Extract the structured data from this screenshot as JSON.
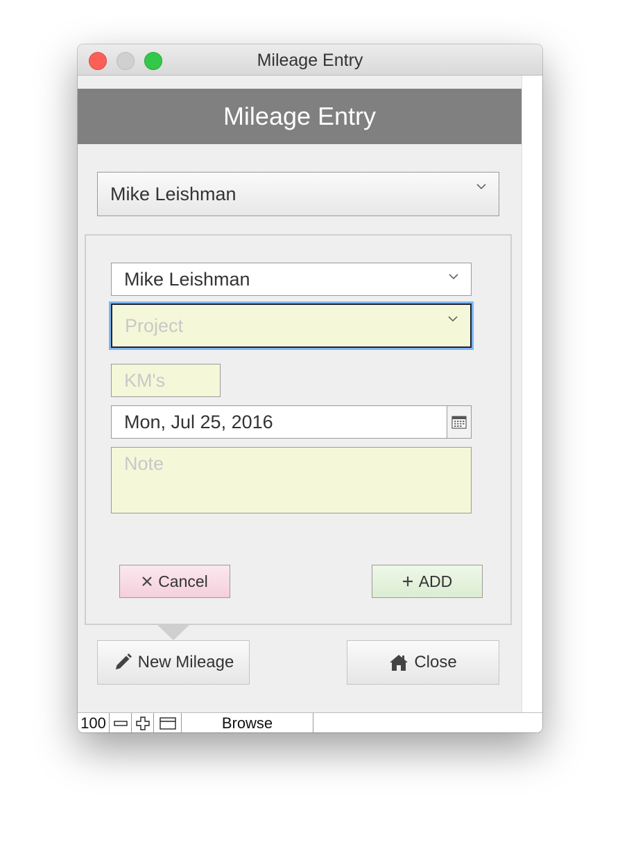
{
  "window": {
    "title": "Mileage Entry"
  },
  "header": {
    "title": "Mileage Entry"
  },
  "employee_select": {
    "value": "Mike Leishman"
  },
  "form": {
    "name_value": "Mike Leishman",
    "project_placeholder": "Project",
    "km_placeholder": "KM's",
    "date_value": "Mon, Jul 25, 2016",
    "note_placeholder": "Note"
  },
  "buttons": {
    "cancel_label": "Cancel",
    "add_label": "ADD",
    "new_mileage_label": "New Mileage",
    "close_label": "Close"
  },
  "statusbar": {
    "zoom": "100",
    "mode": "Browse"
  },
  "colors": {
    "header_band": "#808080",
    "required_field": "#f4f8d9",
    "cancel_button": "#f5cfdc",
    "add_button": "#dcedd2",
    "focus_ring": "#7fb5f0"
  },
  "icons": [
    "close-dot-icon",
    "minimize-dot-icon",
    "zoom-dot-icon",
    "chevron-down-icon",
    "calendar-icon",
    "x-icon",
    "plus-icon",
    "pencil-icon",
    "home-icon",
    "zoom-out-icon",
    "zoom-in-icon",
    "layout-mode-icon"
  ]
}
